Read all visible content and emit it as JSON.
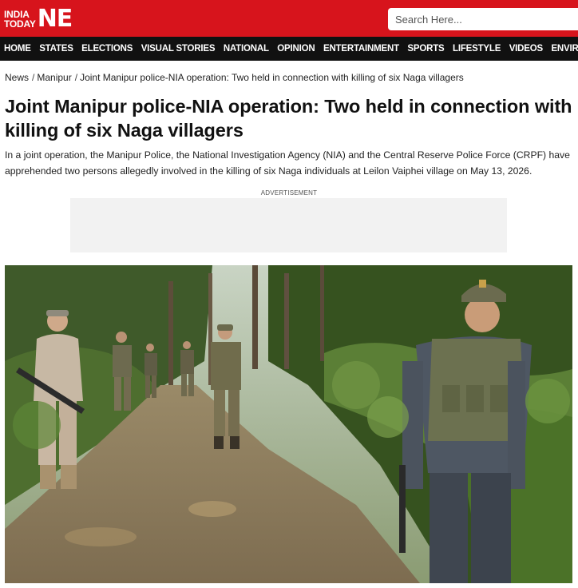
{
  "header": {
    "logo_line1": "INDIA",
    "logo_line2": "TODAY",
    "logo_big": "NE",
    "search_placeholder": "Search Here..."
  },
  "nav": {
    "items": [
      "HOME",
      "STATES",
      "ELECTIONS",
      "VISUAL STORIES",
      "NATIONAL",
      "OPINION",
      "ENTERTAINMENT",
      "SPORTS",
      "LIFESTYLE",
      "VIDEOS",
      "ENVIRONMENT"
    ]
  },
  "breadcrumb": {
    "items": [
      "News",
      "Manipur",
      "Joint Manipur police-NIA operation: Two held in connection with killing of six Naga villagers"
    ]
  },
  "article": {
    "title": "Joint Manipur police-NIA operation: Two held in connection with killing of six Naga villagers",
    "summary": "In a joint operation, the Manipur Police, the National Investigation Agency (NIA) and the Central Reserve Police Force (CRPF) have apprehended two persons allegedly involved in the killing of six Naga individuals at Leilon Vaiphei village on May 13, 2026."
  },
  "ad": {
    "label": "ADVERTISEMENT"
  },
  "colors": {
    "brand_red": "#d7141c",
    "nav_bg": "#111111"
  }
}
